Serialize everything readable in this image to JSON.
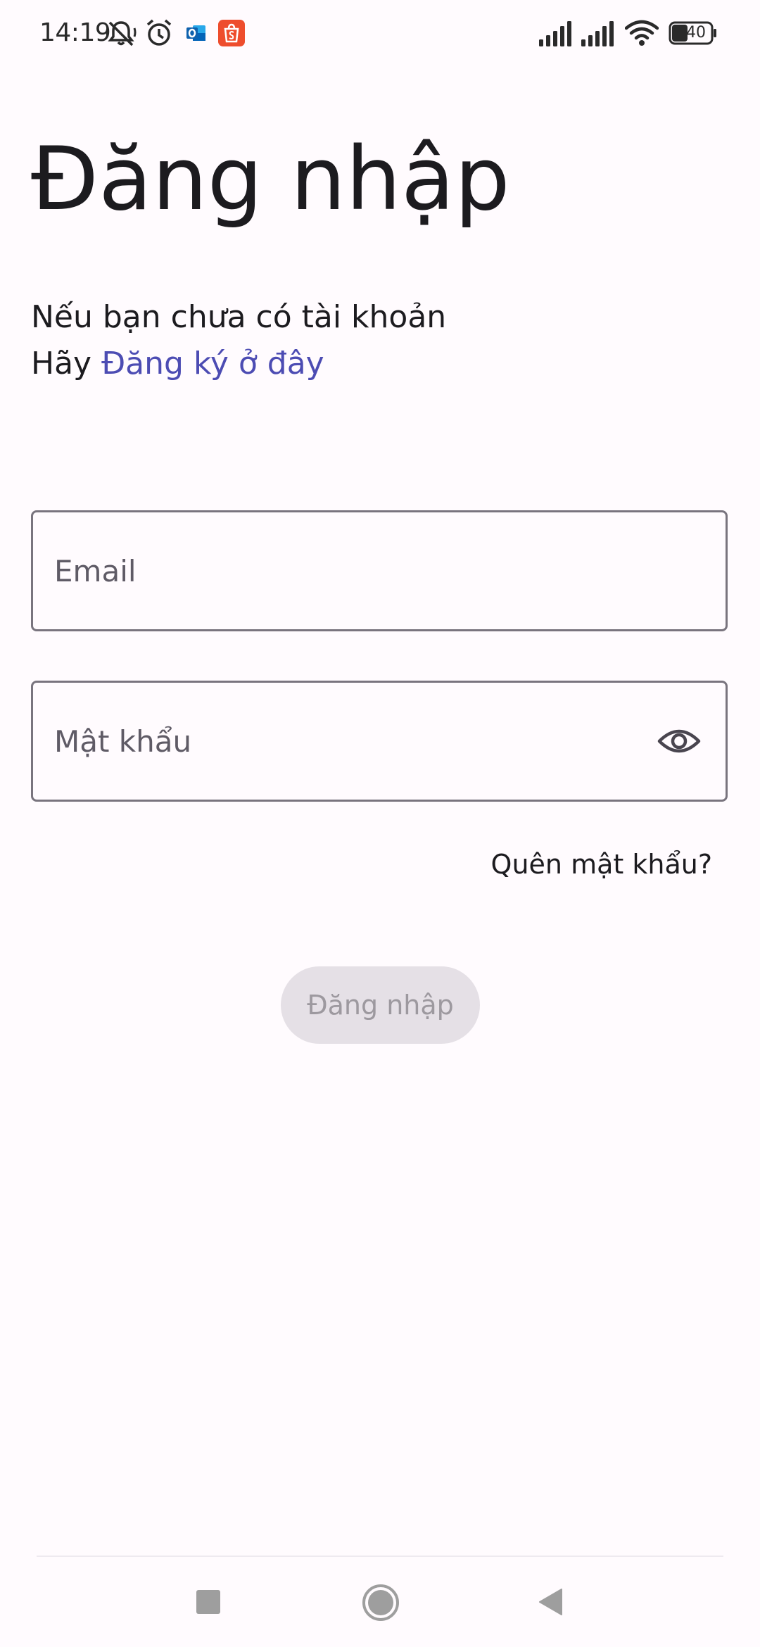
{
  "status_bar": {
    "time": "14:19",
    "icons": [
      "mute-icon",
      "alarm-icon",
      "outlook-icon",
      "shopee-icon",
      "signal-icon",
      "signal-icon",
      "wifi-icon",
      "battery-icon"
    ],
    "battery_level": "40"
  },
  "login": {
    "title": "Đăng nhập",
    "register_prompt_line1": "Nếu bạn chưa có tài khoản",
    "register_prompt_prefix": "Hãy ",
    "register_link": "Đăng ký ở đây",
    "email_placeholder": "Email",
    "password_placeholder": "Mật khẩu",
    "password_toggle_icon": "eye-icon",
    "forgot_password": "Quên mật khẩu?",
    "submit_label": "Đăng nhập"
  },
  "colors": {
    "background": "#fffbfe",
    "link": "#4c4cb3",
    "outline": "#79747e",
    "disabled_button_bg": "#e5e0e6",
    "disabled_button_text": "#9d999f"
  },
  "nav_bar": {
    "buttons": [
      "recent-apps-icon",
      "home-icon",
      "back-icon"
    ]
  }
}
